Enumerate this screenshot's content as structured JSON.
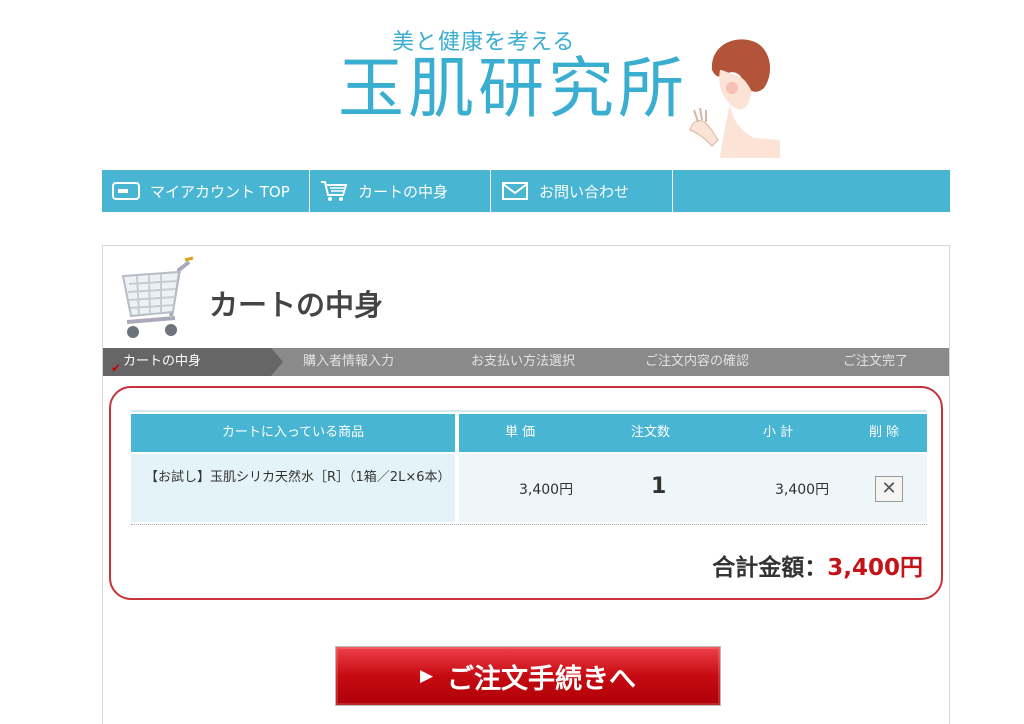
{
  "header": {
    "tagline": "美と健康を考える",
    "logo": "玉肌研究所"
  },
  "nav": {
    "items": [
      {
        "label": "マイアカウント TOP",
        "icon": "card-icon"
      },
      {
        "label": "カートの中身",
        "icon": "cart-icon"
      },
      {
        "label": "お問い合わせ",
        "icon": "mail-icon"
      }
    ]
  },
  "page": {
    "title": "カートの中身"
  },
  "steps": [
    {
      "label": "カートの中身",
      "active": true
    },
    {
      "label": "購入者情報入力",
      "active": false
    },
    {
      "label": "お支払い方法選択",
      "active": false
    },
    {
      "label": "ご注文内容の確認",
      "active": false
    },
    {
      "label": "ご注文完了",
      "active": false
    }
  ],
  "cart_table": {
    "headers": {
      "product": "カートに入っている商品",
      "unit_price": "単 価",
      "quantity": "注文数",
      "subtotal": "小 計",
      "delete": "削 除"
    },
    "rows": [
      {
        "product": "【お試し】玉肌シリカ天然水［R］（1箱／2L×6本）",
        "unit_price": "3,400円",
        "quantity": "1",
        "subtotal": "3,400円",
        "delete_symbol": "✕"
      }
    ]
  },
  "total": {
    "label": "合計金額：",
    "amount": "3,400円"
  },
  "order_button": {
    "arrow": "▶",
    "label": "ご注文手続きへ"
  },
  "colors": {
    "accent": "#48b5d3",
    "total_red": "#c4141a",
    "frame_red": "#c8323a",
    "button_red": "#c60a12"
  }
}
